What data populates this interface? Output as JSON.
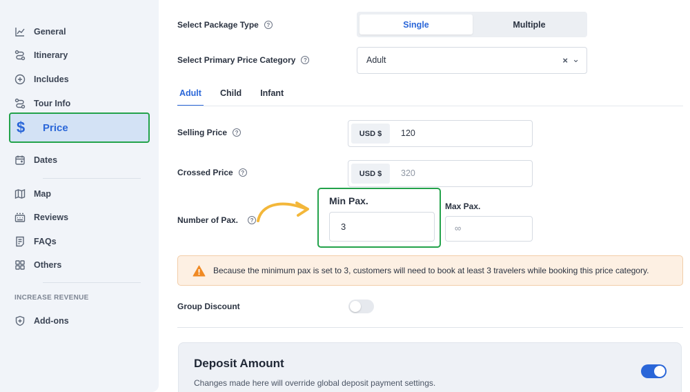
{
  "sidebar": {
    "items": [
      {
        "label": "General",
        "icon": "chart-line-icon"
      },
      {
        "label": "Itinerary",
        "icon": "route-icon"
      },
      {
        "label": "Includes",
        "icon": "plus-circle-icon"
      },
      {
        "label": "Tour Info",
        "icon": "route-icon"
      },
      {
        "label": "Price",
        "icon": "dollar-icon",
        "active": true
      },
      {
        "label": "Dates",
        "icon": "calendar-icon"
      },
      {
        "label": "Map",
        "icon": "map-icon"
      },
      {
        "label": "Reviews",
        "icon": "reviews-icon"
      },
      {
        "label": "FAQs",
        "icon": "faq-icon"
      },
      {
        "label": "Others",
        "icon": "grid-icon"
      },
      {
        "label": "Add-ons",
        "icon": "shield-plus-icon"
      }
    ],
    "section_label": "INCREASE REVENUE",
    "price_glyph": "$"
  },
  "package_type": {
    "label": "Select Package Type",
    "options": [
      "Single",
      "Multiple"
    ],
    "selected": "Single"
  },
  "price_category": {
    "label": "Select Primary Price Category",
    "value": "Adult",
    "clear_glyph": "×",
    "chevron_glyph": "⌄"
  },
  "tabs": [
    "Adult",
    "Child",
    "Infant"
  ],
  "active_tab": "Adult",
  "selling_price": {
    "label": "Selling Price",
    "currency": "USD $",
    "value": "120"
  },
  "crossed_price": {
    "label": "Crossed Price",
    "currency": "USD $",
    "placeholder": "320"
  },
  "pax": {
    "label": "Number of Pax.",
    "min_label": "Min Pax.",
    "min_value": "3",
    "max_label": "Max Pax.",
    "max_value": "∞"
  },
  "notice": {
    "text": "Because the minimum pax is set to 3, customers will need to book at least 3 travelers while booking this price category."
  },
  "group_discount": {
    "label": "Group Discount",
    "enabled": false
  },
  "deposit": {
    "title": "Deposit Amount",
    "subtitle": "Changes made here will override global deposit payment settings.",
    "enabled": true
  },
  "help_glyph": "?",
  "colors": {
    "accent": "#2a66d8",
    "highlight_border": "#22a24a",
    "warning": "#f08a24",
    "arrow": "#f3b73a"
  }
}
